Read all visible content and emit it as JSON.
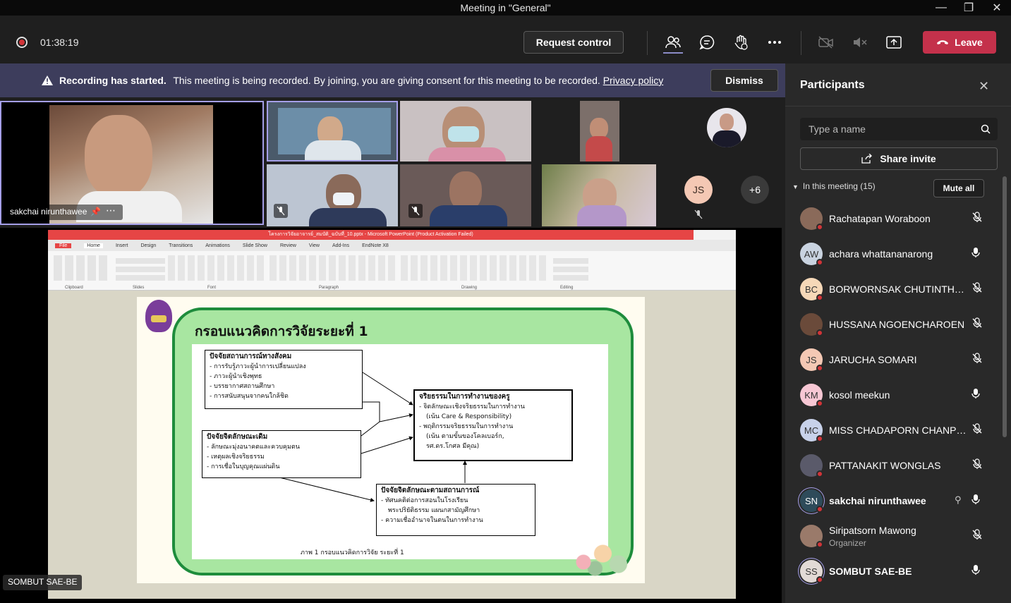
{
  "window": {
    "title": "Meeting in \"General\""
  },
  "toolbar": {
    "timer": "01:38:19",
    "request_control": "Request control",
    "leave": "Leave"
  },
  "banner": {
    "bold": "Recording has started.",
    "text": "This meeting is being recorded. By joining, you are giving consent for this meeting to be recorded.",
    "link": "Privacy policy",
    "dismiss": "Dismiss"
  },
  "videos": {
    "main_name": "sakchai nirunthawee",
    "more_count": "+6",
    "js_initials": "JS"
  },
  "presenter": "SOMBUT SAE-BE",
  "ppt": {
    "title": "โครงการวิจัยอาจารย์_สมบัติ_ฉบับที่_10.pptx - Microsoft PowerPoint (Product Activation Failed)",
    "tabs": [
      "File",
      "Home",
      "Insert",
      "Design",
      "Transitions",
      "Animations",
      "Slide Show",
      "Review",
      "View",
      "Add-Ins",
      "EndNote X8"
    ],
    "groups": [
      "Clipboard",
      "Slides",
      "Font",
      "Paragraph",
      "Drawing",
      "Editing"
    ],
    "slide": {
      "heading": "กรอบแนวคิดการวิจัยระยะที่ 1",
      "box1_title": "ปัจจัยสถานการณ์ทางสังคม",
      "box1_items": [
        "- การรับรู้ภาวะผู้นำการเปลี่ยนแปลง",
        "- ภาวะผู้นำเชิงพุทธ",
        "- บรรยากาศสถานศึกษา",
        "- การสนับสนุนจากคนใกล้ชิด"
      ],
      "box2_title": "ปัจจัยจิตลักษณะเดิม",
      "box2_items": [
        "- ลักษณะมุ่งอนาคตและควบคุมตน",
        "- เหตุผลเชิงจริยธรรม",
        "- การเชื่อในบุญคุณแผ่นดิน"
      ],
      "box3_title": "จริยธรรมในการทำงานของครู",
      "box3_items": [
        "- จิตลักษณะเชิงจริยธรรมในการทำงาน",
        "(เน้น Care & Responsibility)",
        "- พฤติกรรมจริยธรรมในการทำงาน",
        "(เน้น ตามขั้นของโคลเบอร์ก,",
        "รศ.ดร.โกศล มีคุณ)"
      ],
      "box4_title": "ปัจจัยจิตลักษณะตามสถานการณ์",
      "box4_items": [
        "- ทัศนคติต่อการสอนในโรงเรียน",
        "พระปริยัติธรรม แผนกสามัญศึกษา",
        "- ความเชื่ออำนาจในตนในการทำงาน"
      ],
      "caption": "ภาพ 1 กรอบแนวคิดการวิจัย ระยะที่ 1"
    }
  },
  "panel": {
    "title": "Participants",
    "search_placeholder": "Type a name",
    "share_invite": "Share invite",
    "section": "In this meeting (15)",
    "mute_all": "Mute all",
    "participants": [
      {
        "name": "Rachatapan Woraboon",
        "initials": "",
        "color": "#8a6a5a",
        "mic": "off"
      },
      {
        "name": "achara whattananarong",
        "initials": "AW",
        "color": "#c9d3e0",
        "mic": "on"
      },
      {
        "name": "BORWORNSAK CHUTINTHARANGKUL",
        "initials": "BC",
        "color": "#f6d8b8",
        "mic": "off"
      },
      {
        "name": "HUSSANA NGOENCHAROEN",
        "initials": "",
        "color": "#6a4a3a",
        "mic": "off"
      },
      {
        "name": "JARUCHA SOMARI",
        "initials": "JS",
        "color": "#f4c8b4",
        "mic": "off"
      },
      {
        "name": "kosol meekun",
        "initials": "KM",
        "color": "#f7c7d4",
        "mic": "on"
      },
      {
        "name": "MISS CHADAPORN CHANPRASERT",
        "initials": "MC",
        "color": "#c8d2ea",
        "mic": "off"
      },
      {
        "name": "PATTANAKIT WONGLAS",
        "initials": "",
        "color": "#5a5a6a",
        "mic": "off"
      },
      {
        "name": "sakchai nirunthawee",
        "initials": "SN",
        "color": "#2e4b5a",
        "mic": "on"
      },
      {
        "name": "Siripatsorn Mawong",
        "role": "Organizer",
        "initials": "",
        "color": "#9a7a6a",
        "mic": "off"
      },
      {
        "name": "SOMBUT SAE-BE",
        "initials": "SS",
        "color": "#e2dad6",
        "mic": "on"
      }
    ]
  }
}
